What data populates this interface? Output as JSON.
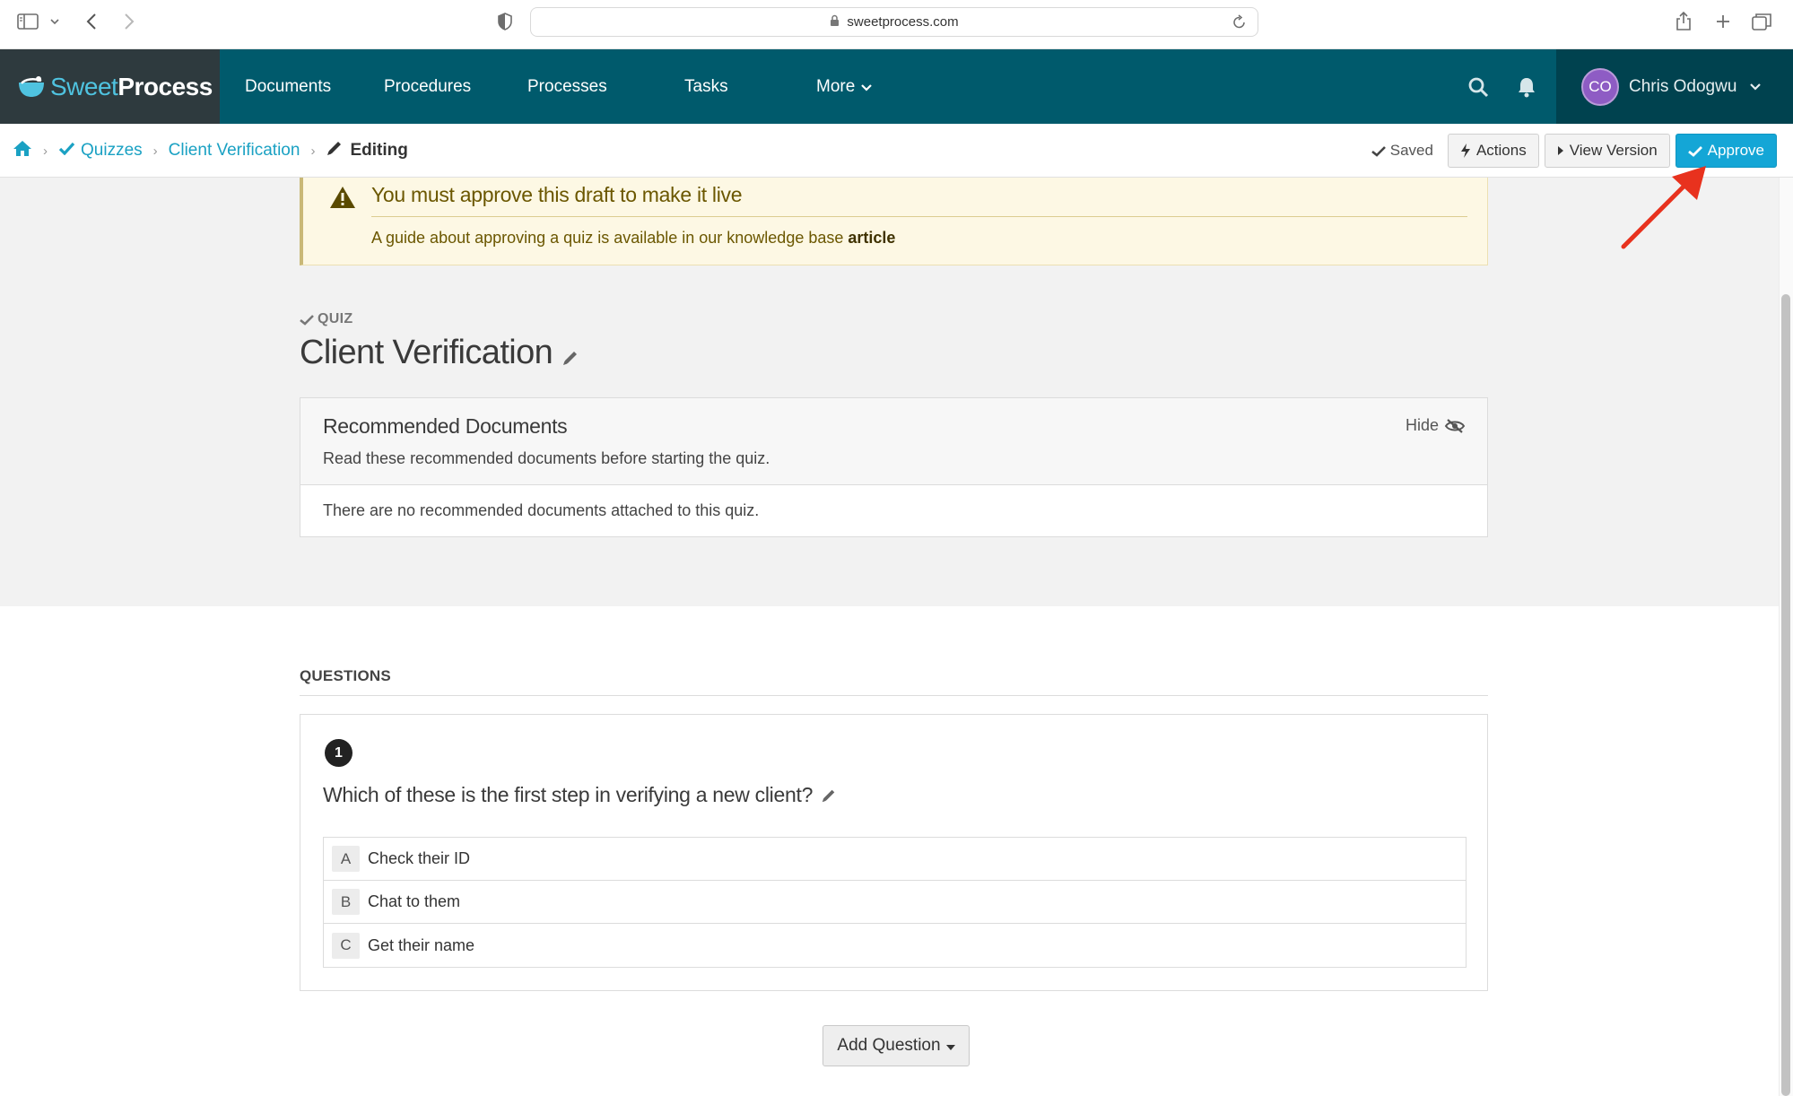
{
  "browser": {
    "url": "sweetprocess.com"
  },
  "nav": {
    "brand_sweet": "Sweet",
    "brand_process": "Process",
    "items": [
      {
        "label": "Documents"
      },
      {
        "label": "Procedures"
      },
      {
        "label": "Processes"
      },
      {
        "label": "Tasks"
      },
      {
        "label": "More"
      }
    ],
    "user": {
      "initials": "CO",
      "name": "Chris Odogwu"
    }
  },
  "breadcrumb": {
    "quizzes": "Quizzes",
    "client_verification": "Client Verification",
    "current": "Editing"
  },
  "actions": {
    "saved": "Saved",
    "actions_label": "Actions",
    "view_version": "View Version",
    "approve": "Approve"
  },
  "alert": {
    "title": "You must approve this draft to make it live",
    "message": "A guide about approving a quiz is available in our knowledge base",
    "link": "article"
  },
  "quiz": {
    "label": "QUIZ",
    "title": "Client Verification"
  },
  "recommended": {
    "title": "Recommended Documents",
    "subtitle": "Read these recommended documents before starting the quiz.",
    "hide": "Hide",
    "empty": "There are no recommended documents attached to this quiz."
  },
  "questions": {
    "heading": "QUESTIONS",
    "items": [
      {
        "number": "1",
        "text": "Which of these is the first step in verifying a new client?",
        "answers": [
          {
            "letter": "A",
            "text": "Check their ID"
          },
          {
            "letter": "B",
            "text": "Chat to them"
          },
          {
            "letter": "C",
            "text": "Get their name"
          }
        ]
      }
    ],
    "add_button": "Add Question"
  },
  "colors": {
    "nav_bg": "#005a6c",
    "brand_bg": "#2e3a3e",
    "user_bg": "#00424f",
    "link": "#1aa1c3",
    "approve": "#14a6d6",
    "alert_bg": "#fdf8e4",
    "annotation_arrow": "#e8321e"
  }
}
